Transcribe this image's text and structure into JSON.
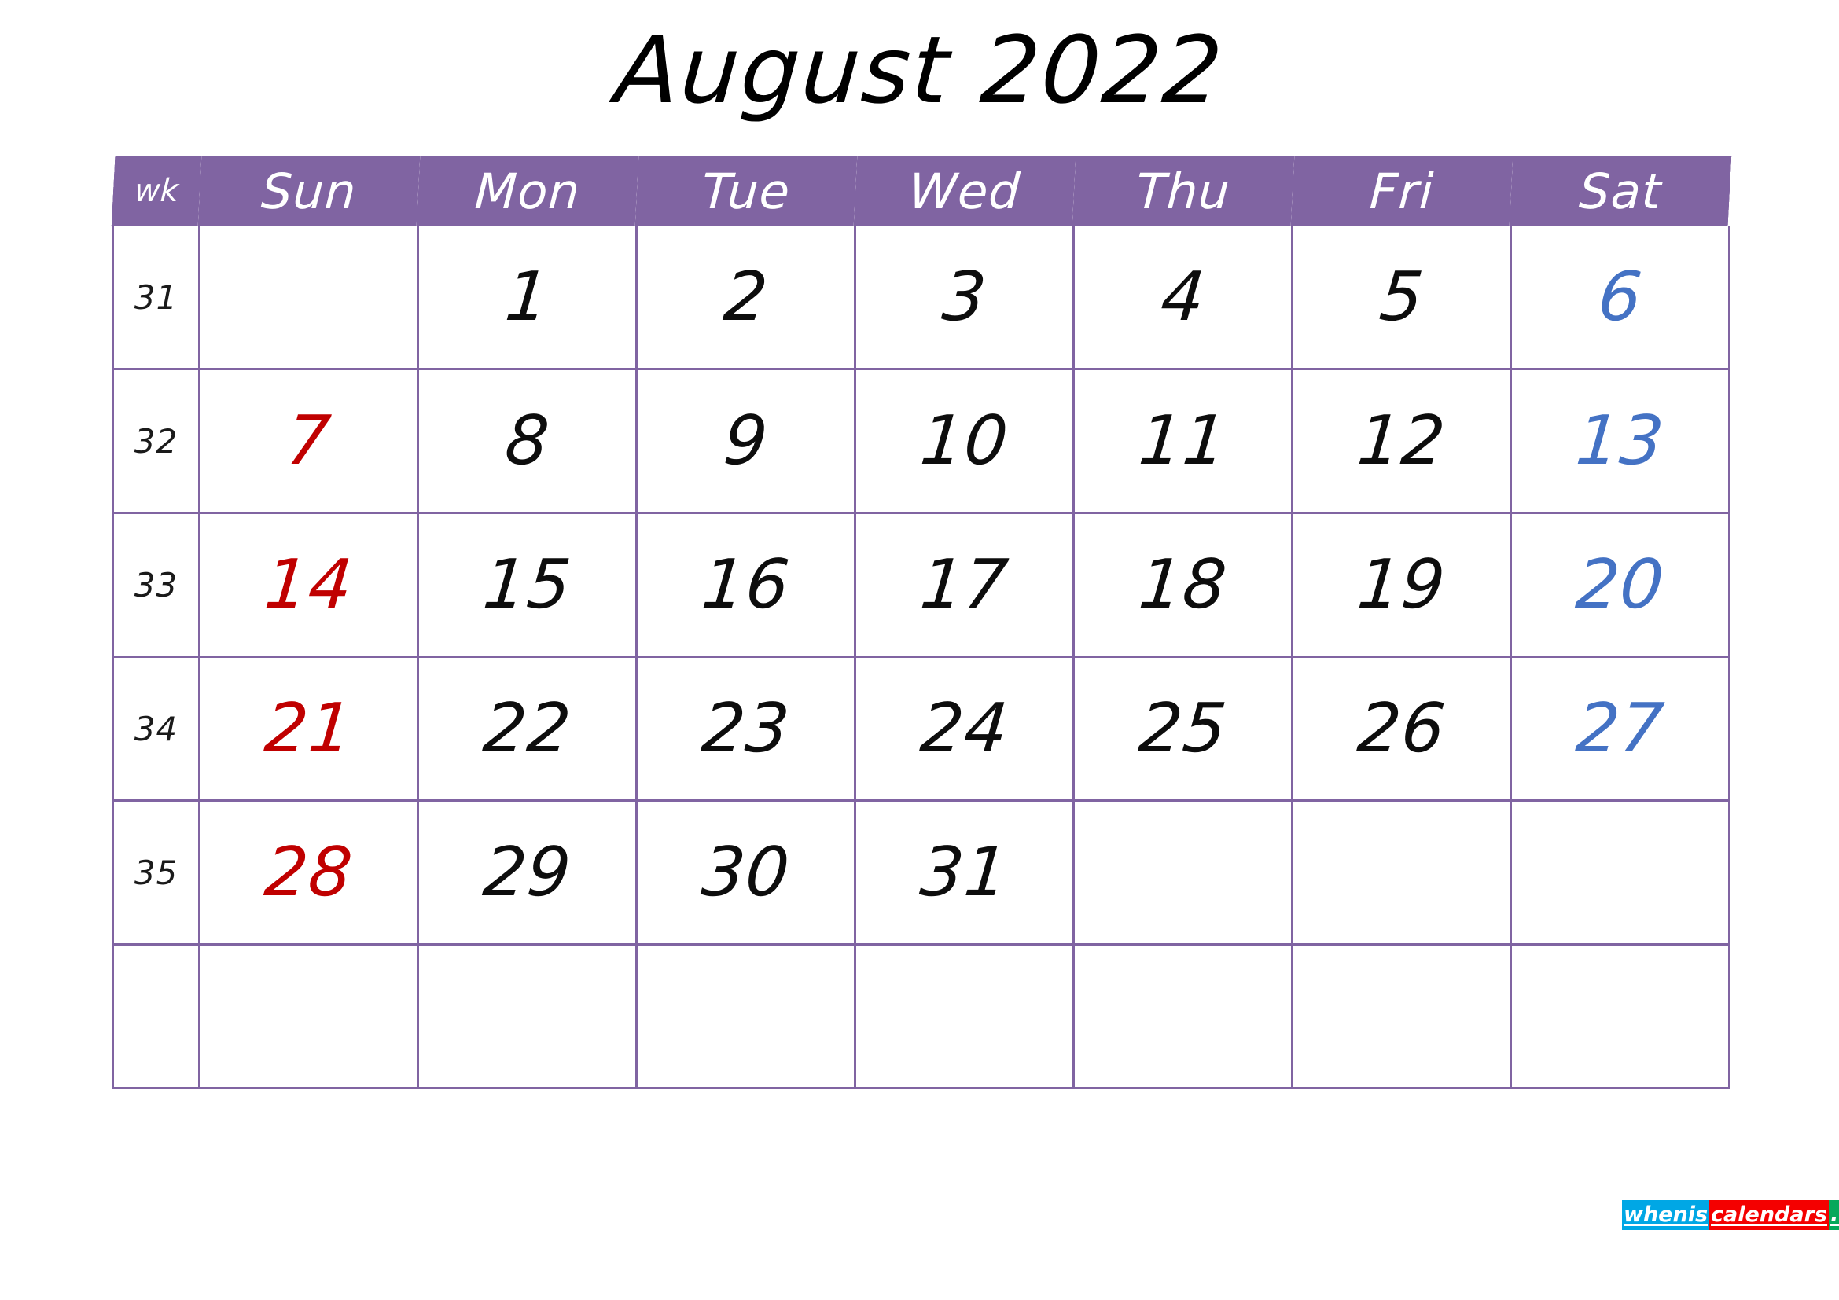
{
  "title": "August 2022",
  "colors": {
    "header_background": "#8064A2",
    "grid_border": "#8064A2",
    "weekday_text": "#0D0D0D",
    "sunday_text": "#C00000",
    "saturday_text": "#4472C4",
    "header_text": "#FFFFFF",
    "logo_blue": "#00A7E5",
    "logo_red": "#F40000",
    "logo_green": "#06A85B"
  },
  "header": {
    "wk_label": "wk",
    "days": [
      "Sun",
      "Mon",
      "Tue",
      "Wed",
      "Thu",
      "Fri",
      "Sat"
    ]
  },
  "weeks": [
    {
      "wk": "31",
      "days": [
        {
          "n": "",
          "kind": "empty"
        },
        {
          "n": "1",
          "kind": "weekday"
        },
        {
          "n": "2",
          "kind": "weekday"
        },
        {
          "n": "3",
          "kind": "weekday"
        },
        {
          "n": "4",
          "kind": "weekday"
        },
        {
          "n": "5",
          "kind": "weekday"
        },
        {
          "n": "6",
          "kind": "saturday"
        }
      ]
    },
    {
      "wk": "32",
      "days": [
        {
          "n": "7",
          "kind": "sunday"
        },
        {
          "n": "8",
          "kind": "weekday"
        },
        {
          "n": "9",
          "kind": "weekday"
        },
        {
          "n": "10",
          "kind": "weekday"
        },
        {
          "n": "11",
          "kind": "weekday"
        },
        {
          "n": "12",
          "kind": "weekday"
        },
        {
          "n": "13",
          "kind": "saturday"
        }
      ]
    },
    {
      "wk": "33",
      "days": [
        {
          "n": "14",
          "kind": "sunday"
        },
        {
          "n": "15",
          "kind": "weekday"
        },
        {
          "n": "16",
          "kind": "weekday"
        },
        {
          "n": "17",
          "kind": "weekday"
        },
        {
          "n": "18",
          "kind": "weekday"
        },
        {
          "n": "19",
          "kind": "weekday"
        },
        {
          "n": "20",
          "kind": "saturday"
        }
      ]
    },
    {
      "wk": "34",
      "days": [
        {
          "n": "21",
          "kind": "sunday"
        },
        {
          "n": "22",
          "kind": "weekday"
        },
        {
          "n": "23",
          "kind": "weekday"
        },
        {
          "n": "24",
          "kind": "weekday"
        },
        {
          "n": "25",
          "kind": "weekday"
        },
        {
          "n": "26",
          "kind": "weekday"
        },
        {
          "n": "27",
          "kind": "saturday"
        }
      ]
    },
    {
      "wk": "35",
      "days": [
        {
          "n": "28",
          "kind": "sunday"
        },
        {
          "n": "29",
          "kind": "weekday"
        },
        {
          "n": "30",
          "kind": "weekday"
        },
        {
          "n": "31",
          "kind": "weekday"
        },
        {
          "n": "",
          "kind": "empty"
        },
        {
          "n": "",
          "kind": "empty"
        },
        {
          "n": "",
          "kind": "empty"
        }
      ]
    },
    {
      "wk": "",
      "days": [
        {
          "n": "",
          "kind": "empty"
        },
        {
          "n": "",
          "kind": "empty"
        },
        {
          "n": "",
          "kind": "empty"
        },
        {
          "n": "",
          "kind": "empty"
        },
        {
          "n": "",
          "kind": "empty"
        },
        {
          "n": "",
          "kind": "empty"
        },
        {
          "n": "",
          "kind": "empty"
        }
      ]
    }
  ],
  "logo": {
    "part1": "whenis",
    "part2": "calendars",
    "part3": ".com"
  }
}
